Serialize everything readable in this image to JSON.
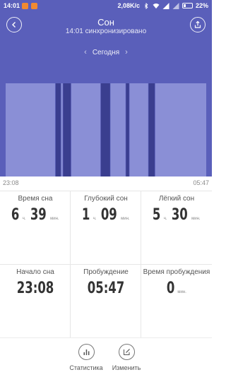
{
  "status_bar": {
    "time": "14:01",
    "speed": "2,08K/c",
    "battery": "22%"
  },
  "header": {
    "title": "Сон",
    "subtitle": "14:01 синхронизировано",
    "date_label": "Сегодня"
  },
  "timeline": {
    "start": "23:08",
    "end": "05:47"
  },
  "chart_data": {
    "type": "timeline",
    "start_time": "23:08",
    "end_time": "05:47",
    "segments": [
      {
        "stage": "light",
        "start": "23:08",
        "end": "00:47"
      },
      {
        "stage": "deep",
        "start": "00:47",
        "end": "00:58"
      },
      {
        "stage": "light",
        "start": "00:58",
        "end": "01:02"
      },
      {
        "stage": "deep",
        "start": "01:02",
        "end": "01:18"
      },
      {
        "stage": "light",
        "start": "01:18",
        "end": "02:17"
      },
      {
        "stage": "deep",
        "start": "02:17",
        "end": "02:36"
      },
      {
        "stage": "light",
        "start": "02:36",
        "end": "03:07"
      },
      {
        "stage": "deep",
        "start": "03:07",
        "end": "03:14"
      },
      {
        "stage": "light",
        "start": "03:14",
        "end": "03:52"
      },
      {
        "stage": "deep",
        "start": "03:52",
        "end": "04:05"
      },
      {
        "stage": "light",
        "start": "04:05",
        "end": "05:47"
      }
    ],
    "colors": {
      "light": "#8a8fd6",
      "deep": "#3a3e8f"
    }
  },
  "stats": [
    {
      "label": "Время сна",
      "parts": [
        {
          "num": "6",
          "unit": "ч."
        },
        {
          "num": "39",
          "unit": "мин."
        }
      ]
    },
    {
      "label": "Глубокий сон",
      "parts": [
        {
          "num": "1",
          "unit": "ч."
        },
        {
          "num": "09",
          "unit": "мин."
        }
      ]
    },
    {
      "label": "Лёгкий сон",
      "parts": [
        {
          "num": "5",
          "unit": "ч."
        },
        {
          "num": "30",
          "unit": "мин."
        }
      ]
    },
    {
      "label": "Начало сна",
      "parts": [
        {
          "num": "23:08",
          "unit": ""
        }
      ]
    },
    {
      "label": "Пробуждение",
      "parts": [
        {
          "num": "05:47",
          "unit": ""
        }
      ]
    },
    {
      "label": "Время пробуждения",
      "parts": [
        {
          "num": "0",
          "unit": "мин."
        }
      ]
    }
  ],
  "bottom_bar": {
    "stats_label": "Статистика",
    "edit_label": "Изменить"
  },
  "colors": {
    "header_bg": "#5a5fba",
    "light_sleep": "#8a8fd6",
    "deep_sleep": "#3a3e8f"
  }
}
